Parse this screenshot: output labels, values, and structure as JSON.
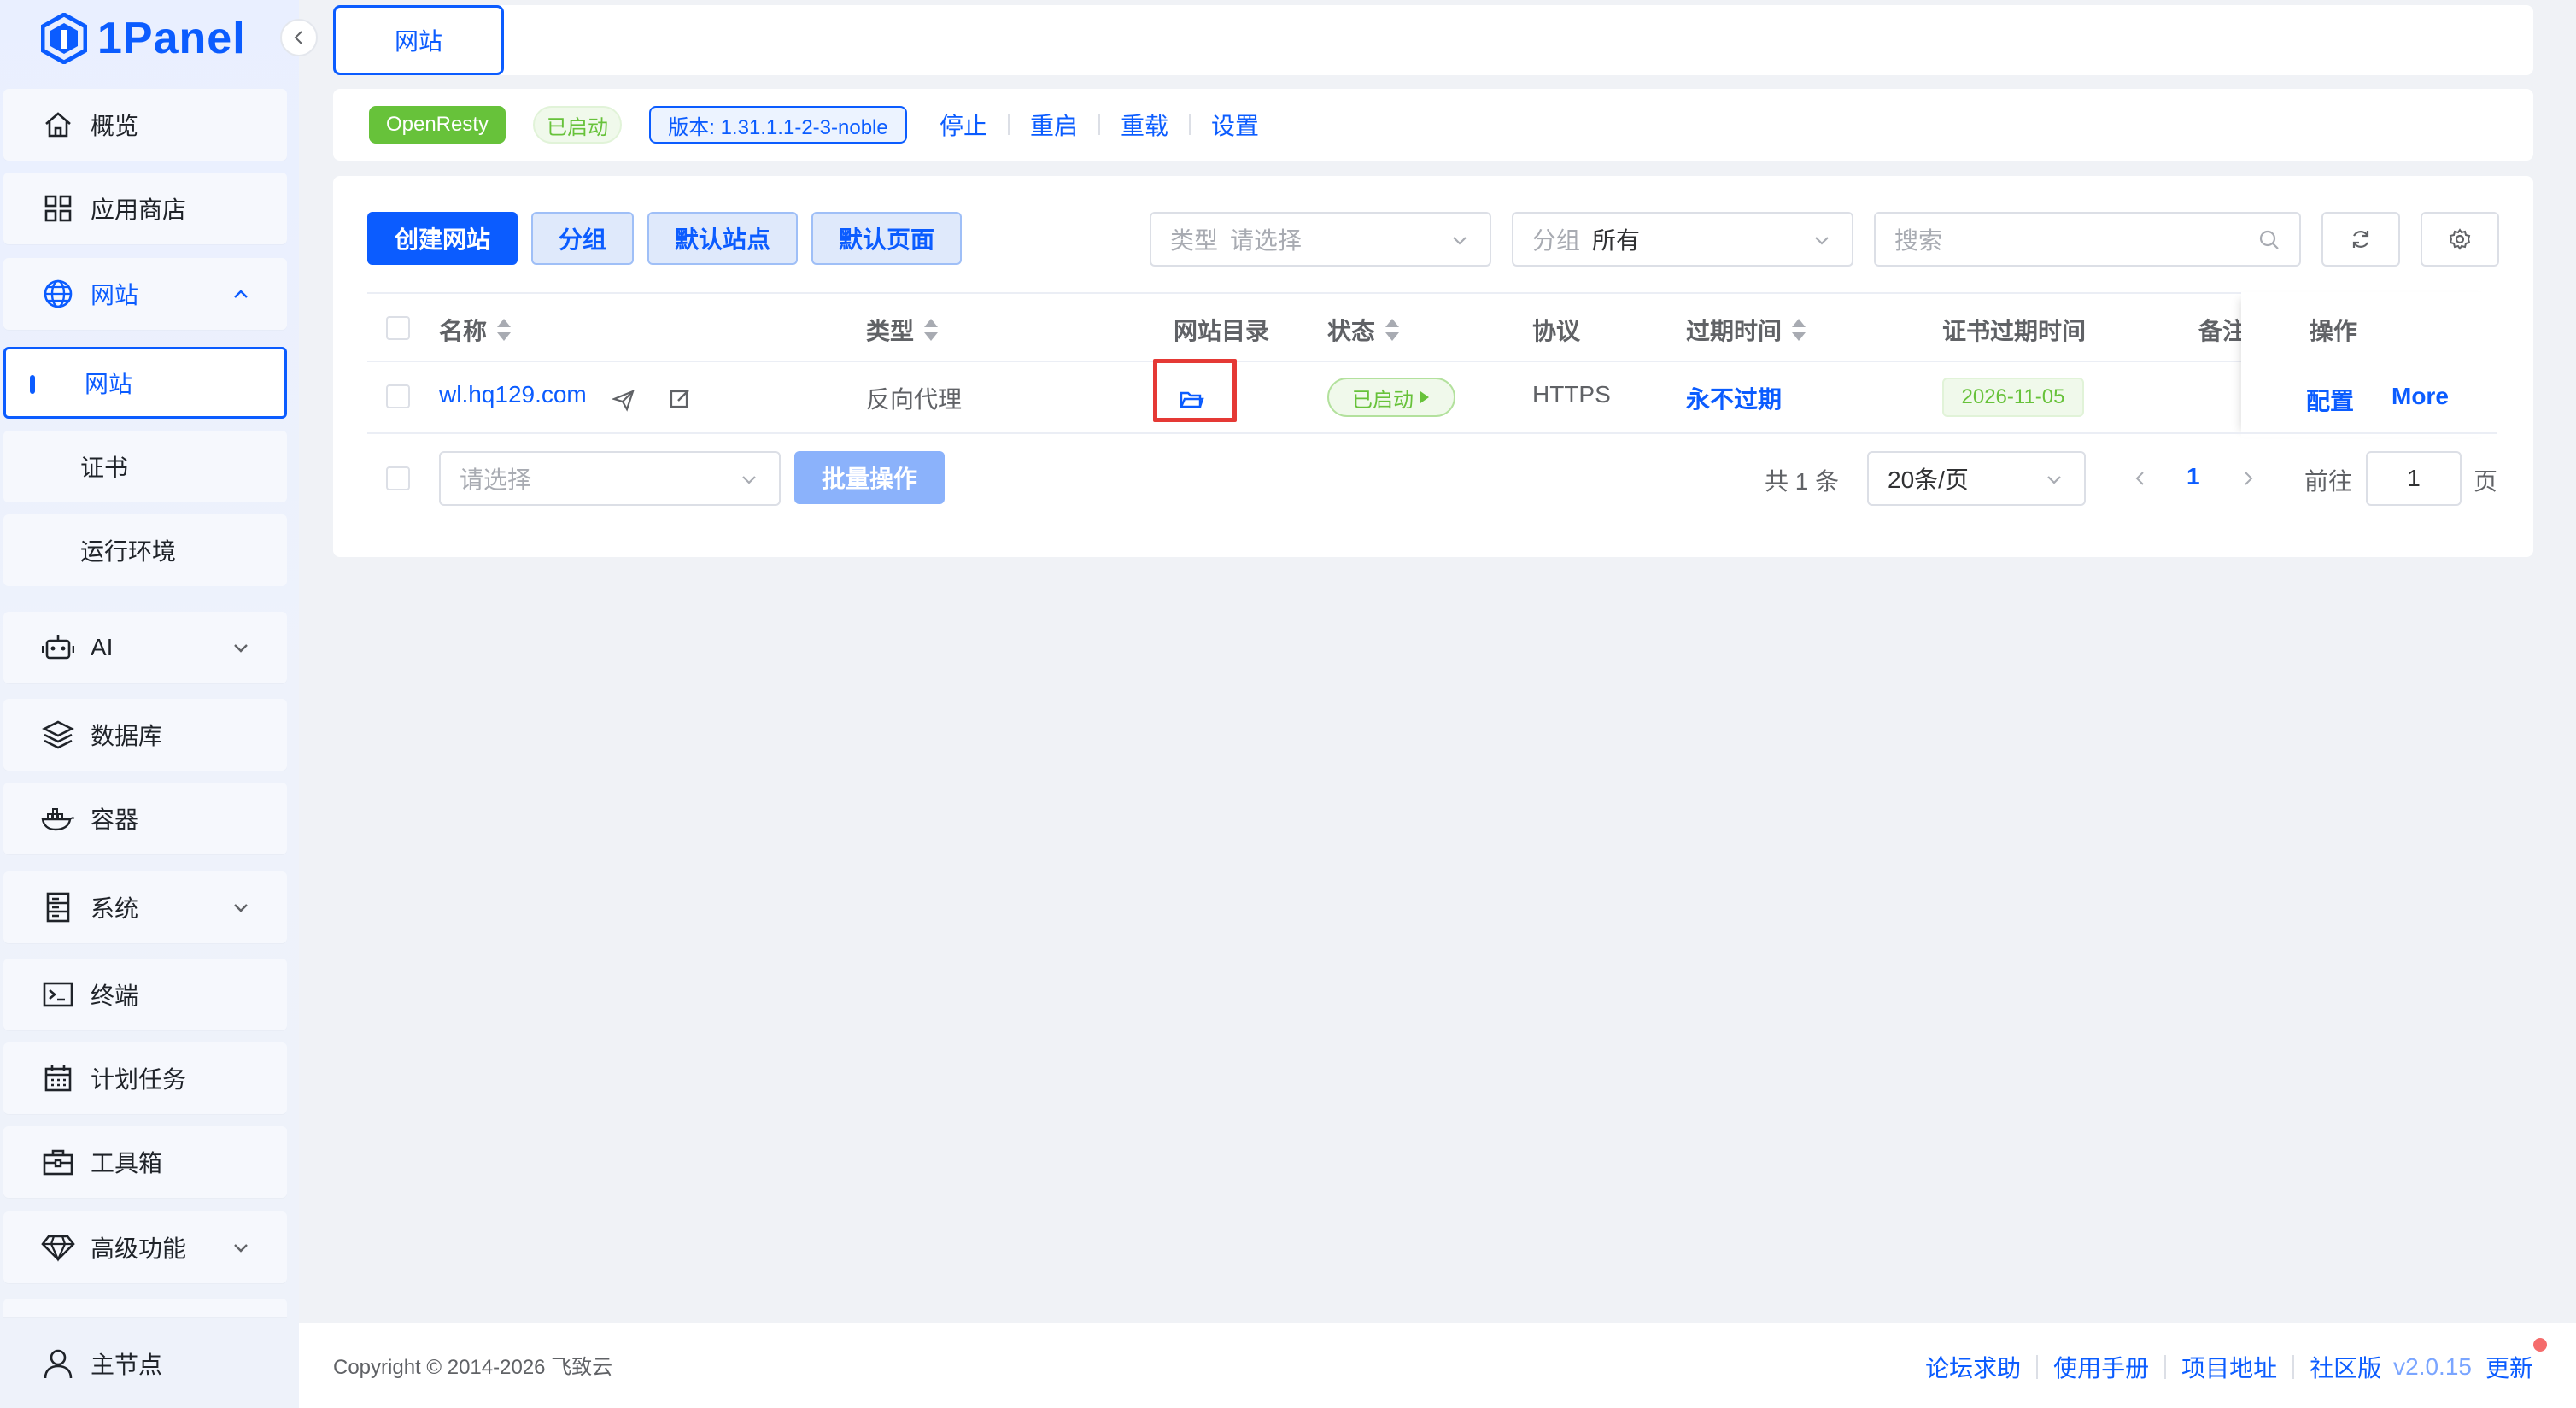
{
  "brand": {
    "name": "1Panel",
    "color": "#0b5cff"
  },
  "sidebar": {
    "items": [
      {
        "label": "概览",
        "icon": "home-icon"
      },
      {
        "label": "应用商店",
        "icon": "grid-icon"
      },
      {
        "label": "网站",
        "icon": "globe-icon",
        "expanded": true,
        "children": [
          {
            "label": "网站",
            "active": true
          },
          {
            "label": "证书"
          },
          {
            "label": "运行环境"
          }
        ]
      },
      {
        "label": "AI",
        "icon": "robot-icon"
      },
      {
        "label": "数据库",
        "icon": "layers-icon"
      },
      {
        "label": "容器",
        "icon": "docker-icon"
      },
      {
        "label": "系统",
        "icon": "server-icon"
      },
      {
        "label": "终端",
        "icon": "terminal-icon"
      },
      {
        "label": "计划任务",
        "icon": "calendar-icon"
      },
      {
        "label": "工具箱",
        "icon": "toolbox-icon"
      },
      {
        "label": "高级功能",
        "icon": "diamond-icon"
      }
    ],
    "node": "主节点"
  },
  "tabs": {
    "active": "网站"
  },
  "openresty": {
    "name": "OpenResty",
    "status": "已启动",
    "version": "版本: 1.31.1.1-2-3-noble",
    "actions": [
      "停止",
      "重启",
      "重载",
      "设置"
    ]
  },
  "toolbar": {
    "create": "创建网站",
    "group": "分组",
    "default_site": "默认站点",
    "default_page": "默认页面",
    "type_prefix": "类型",
    "type_placeholder": "请选择",
    "group_prefix": "分组",
    "group_value": "所有",
    "search_placeholder": "搜索"
  },
  "table": {
    "headers": {
      "name": "名称",
      "type": "类型",
      "dir": "网站目录",
      "status": "状态",
      "protocol": "协议",
      "expire": "过期时间",
      "cert_expire": "证书过期时间",
      "remark": "备注",
      "ops": "操作"
    },
    "rows": [
      {
        "name": "wl.hq129.com",
        "type": "反向代理",
        "status": "已启动",
        "protocol": "HTTPS",
        "expire": "永不过期",
        "cert_expire": "2026-11-05",
        "op_config": "配置",
        "op_more": "More"
      }
    ]
  },
  "batch": {
    "placeholder": "请选择",
    "button": "批量操作"
  },
  "pager": {
    "total": "共 1 条",
    "size": "20条/页",
    "current": "1",
    "goto_label": "前往",
    "goto_value": "1",
    "page_suffix": "页"
  },
  "footer": {
    "copyright": "Copyright © 2014-2026 飞致云",
    "links": [
      "论坛求助",
      "使用手册",
      "项目地址",
      "社区版"
    ],
    "version": "v2.0.15",
    "update": "更新"
  }
}
